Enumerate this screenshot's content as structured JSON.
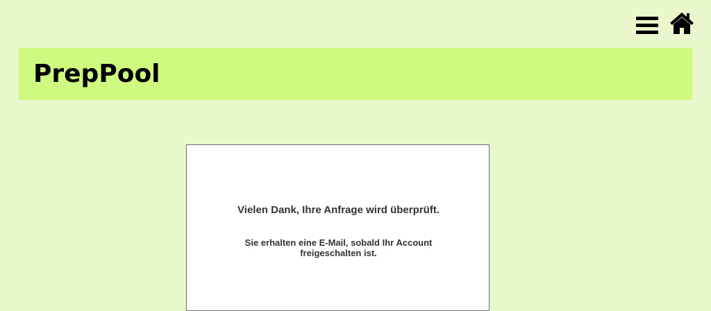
{
  "header": {
    "title": "PrepPool",
    "menu_icon": "hamburger-menu-icon",
    "home_icon": "home-icon"
  },
  "colors": {
    "background": "#e8f8cc",
    "header_band": "#cffa80",
    "card": "#ffffff"
  },
  "card": {
    "primary_message": "Vielen Dank, Ihre Anfrage wird überprüft.",
    "secondary_message": "Sie erhalten eine E-Mail, sobald Ihr Account freigeschalten ist."
  }
}
